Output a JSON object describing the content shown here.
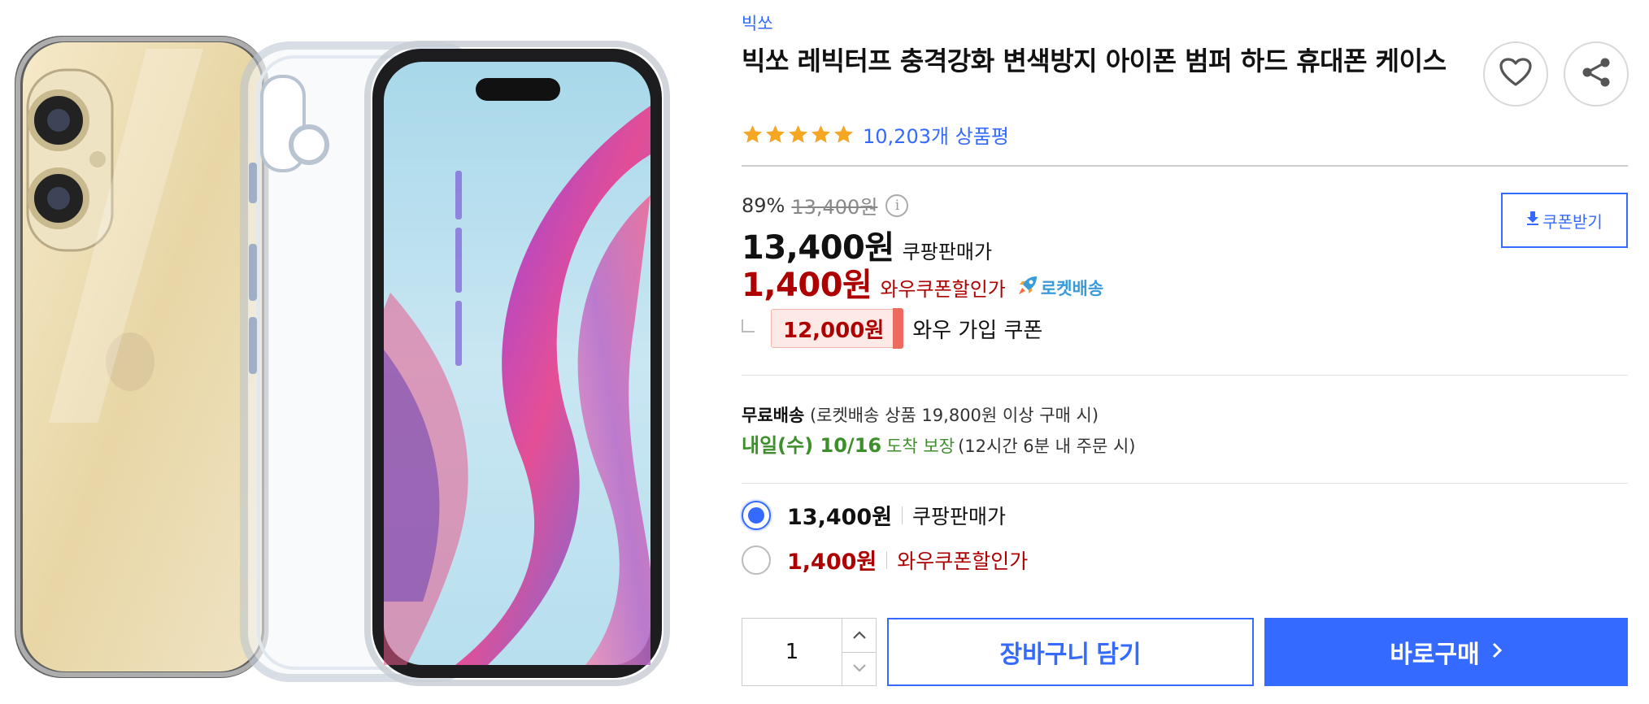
{
  "product": {
    "image_alt": "clear iphone case product photo",
    "brand": "빅쏘",
    "title": "빅쏘 레빅터프 충격강화 변색방지 아이폰 범퍼 하드 휴대폰 케이스",
    "rating_stars": 5,
    "review_count": "10,203개 상품평"
  },
  "actions": {
    "wishlist_icon": "heart-icon",
    "share_icon": "share-icon"
  },
  "price": {
    "discount_rate": "89%",
    "original_price": "13,400원",
    "info_icon": "i",
    "coupon_button": "쿠폰받기",
    "sale_price": "13,400원",
    "sale_label": "쿠팡판매가",
    "wow_price": "1,400원",
    "wow_label": "와우쿠폰할인가",
    "rocket_label": "로켓배송",
    "join_coupon_amount": "12,000원",
    "join_coupon_label": "와우 가입 쿠폰"
  },
  "delivery": {
    "free_label": "무료배송",
    "free_condition": "(로켓배송 상품 19,800원 이상 구매 시)",
    "arrive_date": "내일(수) 10/16",
    "arrive_guarantee": "도착 보장",
    "cutoff": "(12시간 6분 내 주문 시)"
  },
  "options": [
    {
      "price": "13,400원",
      "label": "쿠팡판매가",
      "selected": true
    },
    {
      "price": "1,400원",
      "label": "와우쿠폰할인가",
      "selected": false
    }
  ],
  "purchase": {
    "quantity": "1",
    "cart_button": "장바구니 담기",
    "buy_button": "바로구매"
  },
  "colors": {
    "accent": "#346aff",
    "wow_red": "#ae0000",
    "star": "#f5a623",
    "arrive_green": "#3c8f2a"
  }
}
